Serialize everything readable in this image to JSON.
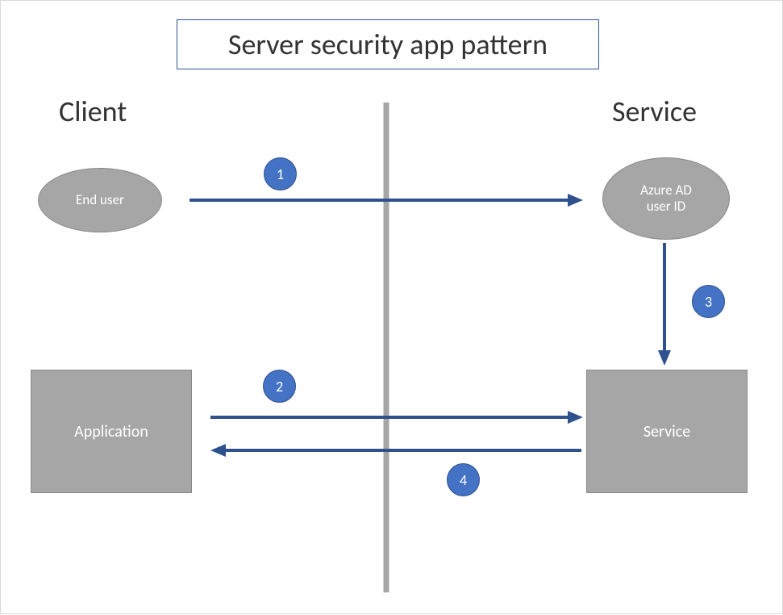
{
  "title": "Server security app pattern",
  "headings": {
    "left": "Client",
    "right": "Service"
  },
  "nodes": {
    "end_user": "End user",
    "azure_ad": "Azure AD\nuser ID",
    "application": "Application",
    "service": "Service"
  },
  "steps": {
    "s1": "1",
    "s2": "2",
    "s3": "3",
    "s4": "4"
  },
  "colors": {
    "accent": "#4472c4",
    "accent_border": "#2f528f",
    "node_fill": "#a6a6a6",
    "title_border": "#2f5496"
  }
}
